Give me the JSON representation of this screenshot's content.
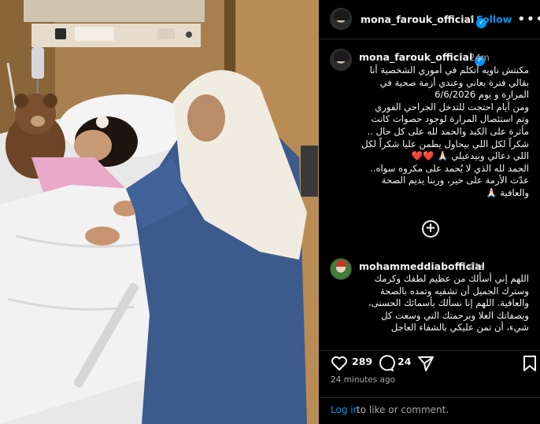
{
  "post": {
    "username": "mona_farouk_official",
    "verified": true,
    "follow_label": "Follow",
    "time": "24m",
    "caption_lines": [
      "مكنتش ناويه أتكلم في أموري الشخصية أنا",
      "بقالي فترة بعاني وعندي أزمة صحية في",
      "المرارة  و يوم 6/6/2026",
      "ومن أيام احتجت للتدخل الجراحي الفوري",
      "وتم استئصال المرارة لوجود حصوات كانت",
      "مأثرة  على الكبد  والحمد لله على كل حال ..",
      "شكراً لكل اللي بيحاول يطمن عليا شكراً لكل",
      "اللي دعالي وبيدعيلي 🙏🏻 ❤️❤️",
      "الحمد لله الذي لا يُحمد على مكروه سواه..",
      "عدّت الأزمة على خير، وربنا يديم الصحة",
      "والعافية 🙏🏻"
    ],
    "likes": "289",
    "comments_count": "24",
    "time_ago": "24 minutes ago"
  },
  "comment": {
    "username": "mohammeddiabofficial",
    "time": "41s",
    "text_lines": [
      "اللهم إني أسألك من عظيم لطفك وكرمك",
      "وسترك الجميل أن تشفيه وتمده بالصحة",
      "والعافية. اللهم إنا نسألك بأسمائك الحسنى،",
      "وبصفاتك العلا وبرحمتك التي وسعت كل",
      "شيء، أن تمن عليكي بالشفاء العاجل"
    ]
  },
  "login": {
    "link_label": "Log in",
    "rest_label": "to like or comment."
  },
  "icons": {
    "like": "heart-icon",
    "comment": "comment-icon",
    "share": "share-icon",
    "save": "bookmark-icon",
    "more": "more-icon",
    "add": "plus-circle-icon"
  },
  "colors": {
    "background": "#000000",
    "accent": "#0095f6",
    "muted": "#a8a8a8"
  }
}
